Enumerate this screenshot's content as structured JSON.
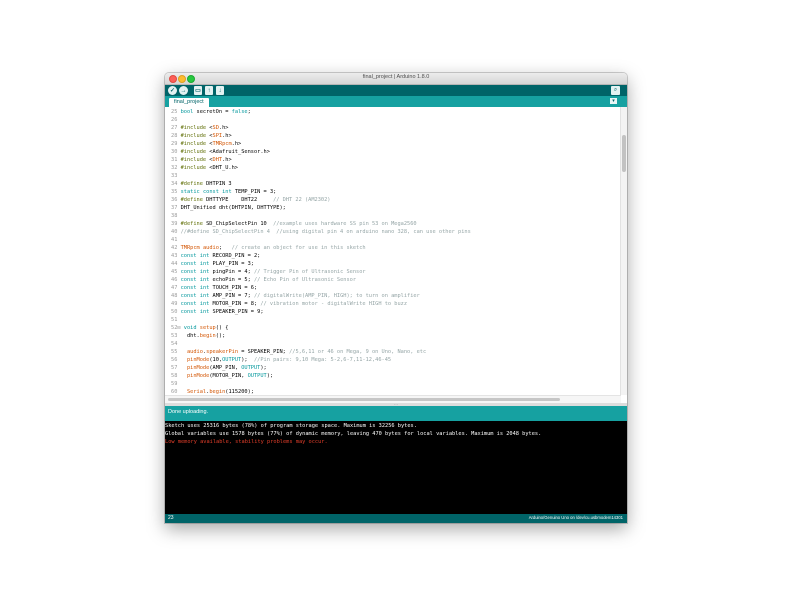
{
  "window": {
    "title": "final_project | Arduino 1.8.0"
  },
  "toolbar": {
    "verify_icon": "✓",
    "upload_icon": "→",
    "new_icon": "▭",
    "open_icon": "↑",
    "save_icon": "↓",
    "serial_monitor_icon": "⌕"
  },
  "tabs": {
    "active": "final_project",
    "menu_icon": "▾"
  },
  "editor": {
    "lines": [
      {
        "n": "25",
        "parts": [
          {
            "t": "bool",
            "c": "kw"
          },
          {
            "t": " secretOn = "
          },
          {
            "t": "false",
            "c": "kw"
          },
          {
            "t": ";"
          }
        ]
      },
      {
        "n": "26",
        "parts": []
      },
      {
        "n": "27",
        "parts": [
          {
            "t": "#include",
            "c": "pp"
          },
          {
            "t": " <"
          },
          {
            "t": "SD",
            "c": "fn"
          },
          {
            "t": ".h>"
          }
        ]
      },
      {
        "n": "28",
        "parts": [
          {
            "t": "#include",
            "c": "pp"
          },
          {
            "t": " <"
          },
          {
            "t": "SPI",
            "c": "fn"
          },
          {
            "t": ".h>"
          }
        ]
      },
      {
        "n": "29",
        "parts": [
          {
            "t": "#include",
            "c": "pp"
          },
          {
            "t": " <"
          },
          {
            "t": "TMRpcm",
            "c": "fn"
          },
          {
            "t": ".h>"
          }
        ]
      },
      {
        "n": "30",
        "parts": [
          {
            "t": "#include",
            "c": "pp"
          },
          {
            "t": " <Adafruit_Sensor.h>"
          }
        ]
      },
      {
        "n": "31",
        "parts": [
          {
            "t": "#include",
            "c": "pp"
          },
          {
            "t": " <"
          },
          {
            "t": "DHT",
            "c": "fn"
          },
          {
            "t": ".h>"
          }
        ]
      },
      {
        "n": "32",
        "parts": [
          {
            "t": "#include",
            "c": "pp"
          },
          {
            "t": " <DHT_U.h>"
          }
        ]
      },
      {
        "n": "33",
        "parts": []
      },
      {
        "n": "34",
        "parts": [
          {
            "t": "#define",
            "c": "pp"
          },
          {
            "t": " DHTPIN 3"
          }
        ]
      },
      {
        "n": "35",
        "parts": [
          {
            "t": "static",
            "c": "kw"
          },
          {
            "t": " "
          },
          {
            "t": "const",
            "c": "kw"
          },
          {
            "t": " "
          },
          {
            "t": "int",
            "c": "kw"
          },
          {
            "t": " TEMP_PIN = 3;"
          }
        ]
      },
      {
        "n": "36",
        "parts": [
          {
            "t": "#define",
            "c": "pp"
          },
          {
            "t": " DHTTYPE    DHT22     "
          },
          {
            "t": "// DHT 22 (AM2302)",
            "c": "cm"
          }
        ]
      },
      {
        "n": "37",
        "parts": [
          {
            "t": "DHT_Unified dht(DHTPIN, DHTTYPE);"
          }
        ]
      },
      {
        "n": "38",
        "parts": []
      },
      {
        "n": "39",
        "parts": [
          {
            "t": "#define",
            "c": "pp"
          },
          {
            "t": " SD_ChipSelectPin 10  "
          },
          {
            "t": "//example uses hardware SS pin 53 on Mega2560",
            "c": "cm"
          }
        ]
      },
      {
        "n": "40",
        "parts": [
          {
            "t": "//#define SD_ChipSelectPin 4  //using digital pin 4 on arduino nano 328, can use other pins",
            "c": "cm"
          }
        ]
      },
      {
        "n": "41",
        "parts": []
      },
      {
        "n": "42",
        "parts": [
          {
            "t": "TMRpcm",
            "c": "fn"
          },
          {
            "t": " "
          },
          {
            "t": "audio",
            "c": "fn"
          },
          {
            "t": ";   "
          },
          {
            "t": "// create an object for use in this sketch",
            "c": "cm"
          }
        ]
      },
      {
        "n": "43",
        "parts": [
          {
            "t": "const",
            "c": "kw"
          },
          {
            "t": " "
          },
          {
            "t": "int",
            "c": "kw"
          },
          {
            "t": " RECORD_PIN = 2;"
          }
        ]
      },
      {
        "n": "44",
        "parts": [
          {
            "t": "const",
            "c": "kw"
          },
          {
            "t": " "
          },
          {
            "t": "int",
            "c": "kw"
          },
          {
            "t": " PLAY_PIN = 3;"
          }
        ]
      },
      {
        "n": "45",
        "parts": [
          {
            "t": "const",
            "c": "kw"
          },
          {
            "t": " "
          },
          {
            "t": "int",
            "c": "kw"
          },
          {
            "t": " pingPin = 4; "
          },
          {
            "t": "// Trigger Pin of Ultrasonic Sensor",
            "c": "cm"
          }
        ]
      },
      {
        "n": "46",
        "parts": [
          {
            "t": "const",
            "c": "kw"
          },
          {
            "t": " "
          },
          {
            "t": "int",
            "c": "kw"
          },
          {
            "t": " echoPin = 5; "
          },
          {
            "t": "// Echo Pin of Ultrasonic Sensor",
            "c": "cm"
          }
        ]
      },
      {
        "n": "47",
        "parts": [
          {
            "t": "const",
            "c": "kw"
          },
          {
            "t": " "
          },
          {
            "t": "int",
            "c": "kw"
          },
          {
            "t": " TOUCH_PIN = 6;"
          }
        ]
      },
      {
        "n": "48",
        "parts": [
          {
            "t": "const",
            "c": "kw"
          },
          {
            "t": " "
          },
          {
            "t": "int",
            "c": "kw"
          },
          {
            "t": " AMP_PIN = 7; "
          },
          {
            "t": "// digitalWrite(AMP_PIN, HIGH); to turn on amplifier",
            "c": "cm"
          }
        ]
      },
      {
        "n": "49",
        "parts": [
          {
            "t": "const",
            "c": "kw"
          },
          {
            "t": " "
          },
          {
            "t": "int",
            "c": "kw"
          },
          {
            "t": " MOTOR_PIN = 8; "
          },
          {
            "t": "// vibration motor - digitalWrite HIGH to buzz",
            "c": "cm"
          }
        ]
      },
      {
        "n": "50",
        "parts": [
          {
            "t": "const",
            "c": "kw"
          },
          {
            "t": " "
          },
          {
            "t": "int",
            "c": "kw"
          },
          {
            "t": " SPEAKER_PIN = 9;"
          }
        ]
      },
      {
        "n": "51",
        "parts": []
      },
      {
        "n": "52⊟",
        "parts": [
          {
            "t": "void",
            "c": "kw"
          },
          {
            "t": " "
          },
          {
            "t": "setup",
            "c": "fn"
          },
          {
            "t": "() {"
          }
        ]
      },
      {
        "n": "53",
        "parts": [
          {
            "t": "  dht."
          },
          {
            "t": "begin",
            "c": "fn"
          },
          {
            "t": "();"
          }
        ]
      },
      {
        "n": "54",
        "parts": []
      },
      {
        "n": "55",
        "parts": [
          {
            "t": "  "
          },
          {
            "t": "audio",
            "c": "fn"
          },
          {
            "t": "."
          },
          {
            "t": "speakerPin",
            "c": "fn"
          },
          {
            "t": " = SPEAKER_PIN; "
          },
          {
            "t": "//5,6,11 or 46 on Mega, 9 on Uno, Nano, etc",
            "c": "cm"
          }
        ]
      },
      {
        "n": "56",
        "parts": [
          {
            "t": "  "
          },
          {
            "t": "pinMode",
            "c": "fn"
          },
          {
            "t": "(10,"
          },
          {
            "t": "OUTPUT",
            "c": "kw"
          },
          {
            "t": ");  "
          },
          {
            "t": "//Pin pairs: 9,10 Mega: 5-2,6-7,11-12,46-45",
            "c": "cm"
          }
        ]
      },
      {
        "n": "57",
        "parts": [
          {
            "t": "  "
          },
          {
            "t": "pinMode",
            "c": "fn"
          },
          {
            "t": "(AMP_PIN, "
          },
          {
            "t": "OUTPUT",
            "c": "kw"
          },
          {
            "t": ");"
          }
        ]
      },
      {
        "n": "58",
        "parts": [
          {
            "t": "  "
          },
          {
            "t": "pinMode",
            "c": "fn"
          },
          {
            "t": "(MOTOR_PIN, "
          },
          {
            "t": "OUTPUT",
            "c": "kw"
          },
          {
            "t": ");"
          }
        ]
      },
      {
        "n": "59",
        "parts": []
      },
      {
        "n": "60",
        "parts": [
          {
            "t": "  "
          },
          {
            "t": "Serial",
            "c": "fn"
          },
          {
            "t": "."
          },
          {
            "t": "begin",
            "c": "fn"
          },
          {
            "t": "(115200);"
          }
        ]
      },
      {
        "n": "61",
        "parts": []
      }
    ]
  },
  "status": {
    "message": "Done uploading."
  },
  "console": {
    "lines": [
      {
        "text": "Sketch uses 25316 bytes (78%) of program storage space. Maximum is 32256 bytes.",
        "type": "normal"
      },
      {
        "text": "Global variables use 1578 bytes (77%) of dynamic memory, leaving 470 bytes for local variables. Maximum is 2048 bytes.",
        "type": "normal"
      },
      {
        "text": "Low memory available, stability problems may occur.",
        "type": "warn"
      }
    ]
  },
  "footer": {
    "line_number": "23",
    "board": "Arduino/Genuino Uno on /dev/cu.usbmodem14301"
  },
  "colors": {
    "toolbar": "#006468",
    "tabbar": "#16a1a1",
    "console_bg": "#000000",
    "warning": "#e33e2a",
    "keyword": "#00979c",
    "function": "#d35400",
    "comment": "#95a5a6"
  }
}
